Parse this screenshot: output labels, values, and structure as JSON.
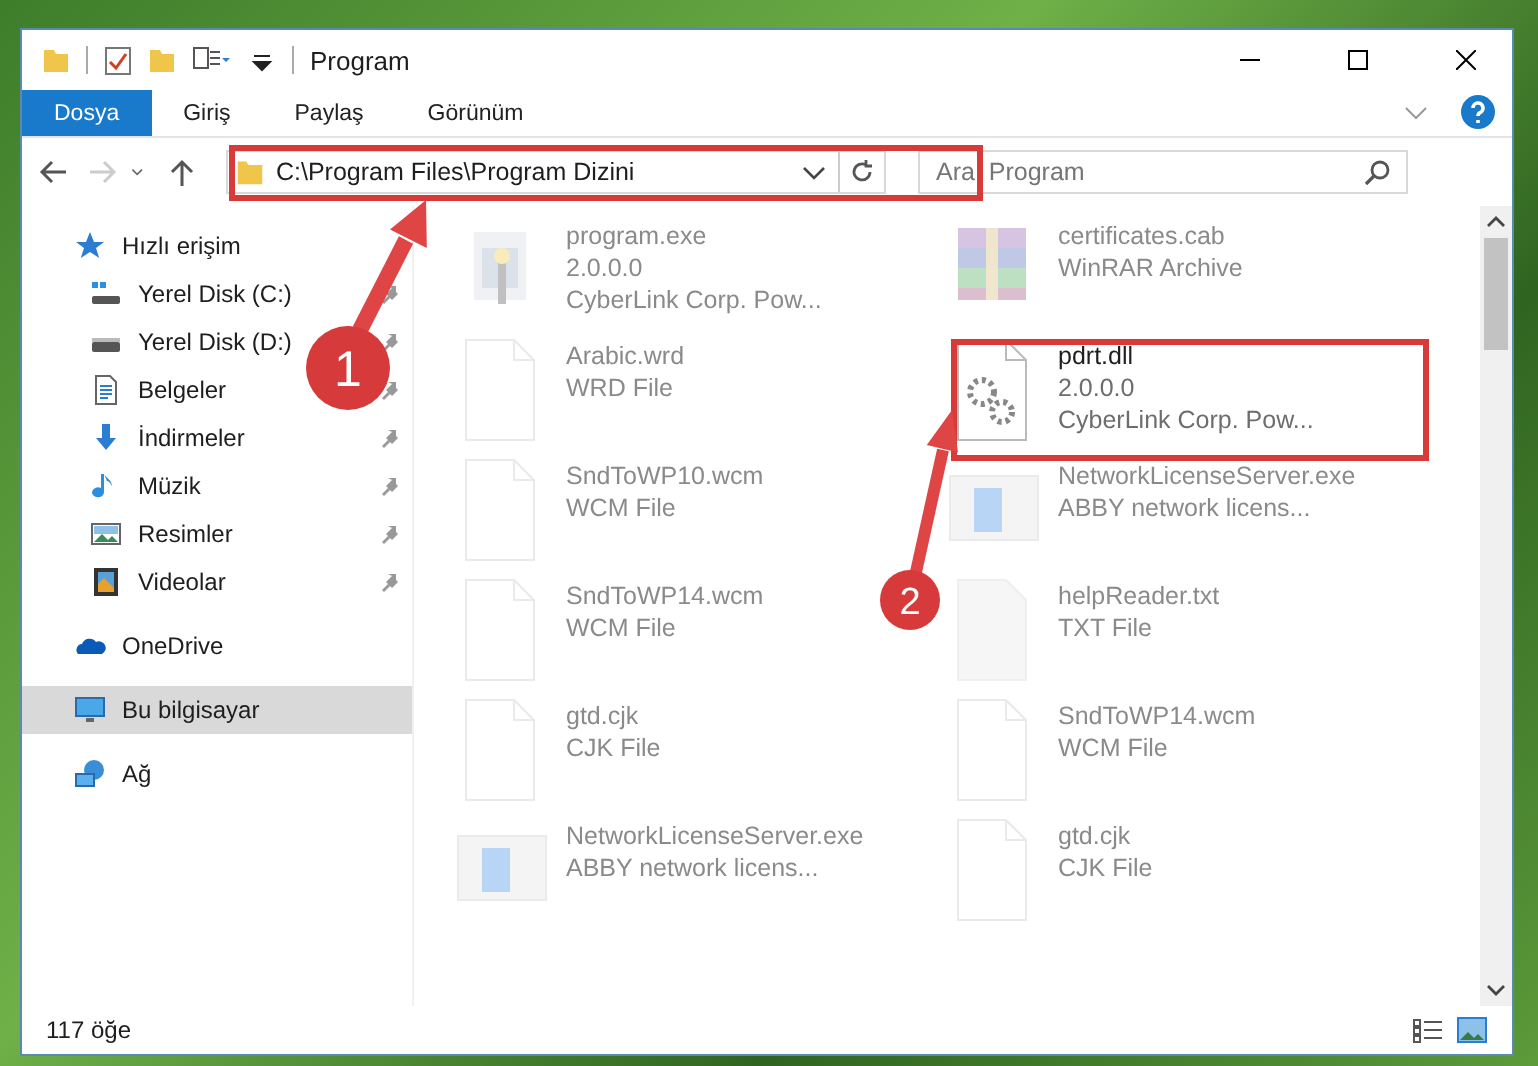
{
  "window": {
    "title": "Program"
  },
  "ribbon_tabs": [
    {
      "label": "Dosya",
      "selected": true
    },
    {
      "label": "Giriş",
      "selected": false
    },
    {
      "label": "Paylaş",
      "selected": false
    },
    {
      "label": "Görünüm",
      "selected": false
    }
  ],
  "address_bar": {
    "path": "C:\\Program Files\\Program Dizini"
  },
  "search": {
    "placeholder": "Ara: Program"
  },
  "sidebar": {
    "items": [
      {
        "kind": "quick-access",
        "label": "Hızlı erişim",
        "selected": false,
        "children": [
          {
            "kind": "drive-c",
            "label": "Yerel Disk (C:)",
            "pinned": true
          },
          {
            "kind": "drive",
            "label": "Yerel Disk (D:)",
            "pinned": true
          },
          {
            "kind": "documents",
            "label": "Belgeler",
            "pinned": true
          },
          {
            "kind": "downloads",
            "label": "İndirmeler",
            "pinned": true
          },
          {
            "kind": "music",
            "label": "Müzik",
            "pinned": true
          },
          {
            "kind": "pictures",
            "label": "Resimler",
            "pinned": true
          },
          {
            "kind": "videos",
            "label": "Videolar",
            "pinned": true
          }
        ]
      },
      {
        "kind": "cloud",
        "label": "OneDrive",
        "selected": false
      },
      {
        "kind": "computer",
        "label": "Bu bilgisayar",
        "selected": true
      },
      {
        "kind": "network",
        "label": "Ağ",
        "selected": false
      }
    ]
  },
  "files": [
    {
      "kind": "installer",
      "name": "program.exe",
      "lines": [
        "2.0.0.0",
        "CyberLink Corp. Pow..."
      ],
      "faded": true
    },
    {
      "kind": "archive",
      "name": "certificates.cab",
      "lines": [
        "WinRAR Archive"
      ],
      "faded": true
    },
    {
      "kind": "blank",
      "name": "Arabic.wrd",
      "lines": [
        "WRD File"
      ],
      "faded": true
    },
    {
      "kind": "gears",
      "name": "pdrt.dll",
      "lines": [
        "2.0.0.0",
        "CyberLink Corp. Pow..."
      ],
      "faded": false
    },
    {
      "kind": "blank",
      "name": "SndToWP10.wcm",
      "lines": [
        "WCM File"
      ],
      "faded": true
    },
    {
      "kind": "app-window",
      "name": "NetworkLicenseServer.exe",
      "lines": [
        "ABBY network licens..."
      ],
      "faded": true
    },
    {
      "kind": "blank",
      "name": "SndToWP14.wcm",
      "lines": [
        "WCM File"
      ],
      "faded": true
    },
    {
      "kind": "text",
      "name": "helpReader.txt",
      "lines": [
        "TXT File"
      ],
      "faded": true
    },
    {
      "kind": "blank",
      "name": "gtd.cjk",
      "lines": [
        "CJK File"
      ],
      "faded": true
    },
    {
      "kind": "blank",
      "name": "SndToWP14.wcm",
      "lines": [
        "WCM File"
      ],
      "faded": true
    },
    {
      "kind": "app-window",
      "name": "NetworkLicenseServer.exe",
      "lines": [
        "ABBY network licens..."
      ],
      "faded": true
    },
    {
      "kind": "blank",
      "name": "gtd.cjk",
      "lines": [
        "CJK File"
      ],
      "faded": true
    }
  ],
  "status_bar": {
    "item_count": "117 öğe"
  },
  "annotations": [
    {
      "number": "1"
    },
    {
      "number": "2"
    }
  ]
}
